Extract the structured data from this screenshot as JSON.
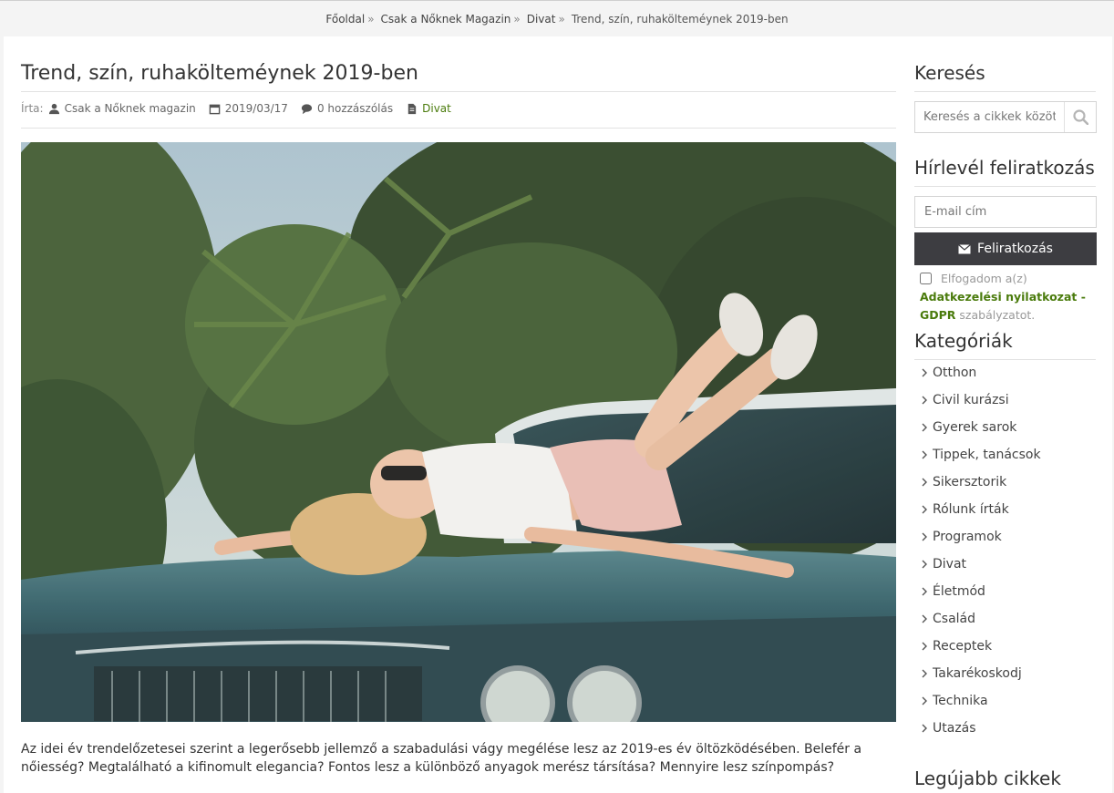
{
  "breadcrumb": {
    "items": [
      "Főoldal",
      "Csak a Nőknek Magazin",
      "Divat"
    ],
    "separator": "»",
    "current": "Trend, szín, ruhakölteméynek 2019-ben"
  },
  "article": {
    "title": "Trend, szín, ruhakölteméynek 2019-ben",
    "meta": {
      "author_label": "Írta:",
      "author": "Csak a Nőknek magazin",
      "date": "2019/03/17",
      "comments": "0 hozzászólás",
      "category": "Divat"
    },
    "body": "Az idei év trendelőzetesei szerint a legerősebb jellemző a szabadulási vágy megélése lesz az 2019-es év öltözködésében. Belefér a nőiesség? Megtalálható a kifinomult elegancia? Fontos lesz a különböző anyagok merész társítása? Mennyire lesz színpompás?"
  },
  "sidebar": {
    "search": {
      "title": "Keresés",
      "placeholder": "Keresés a cikkek között..."
    },
    "newsletter": {
      "title": "Hírlevél feliratkozás",
      "email_placeholder": "E-mail cím",
      "button": "Feliratkozás",
      "gdpr_prefix": "Elfogadom a(z)",
      "gdpr_link": "Adatkezelési nyilatkozat - GDPR",
      "gdpr_suffix": "szabályzatot."
    },
    "categories": {
      "title": "Kategóriák",
      "items": [
        "Otthon",
        "Civil kurázsi",
        "Gyerek sarok",
        "Tippek, tanácsok",
        "Sikersztorik",
        "Rólunk írták",
        "Programok",
        "Divat",
        "Életmód",
        "Család",
        "Receptek",
        "Takarékoskodj",
        "Technika",
        "Utazás"
      ]
    },
    "latest": {
      "title": "Legújabb cikkek"
    }
  },
  "colors": {
    "accent_green": "#4a7b0c",
    "button_dark": "#3d3d41",
    "breadcrumb_bg": "#f4f4f4"
  }
}
